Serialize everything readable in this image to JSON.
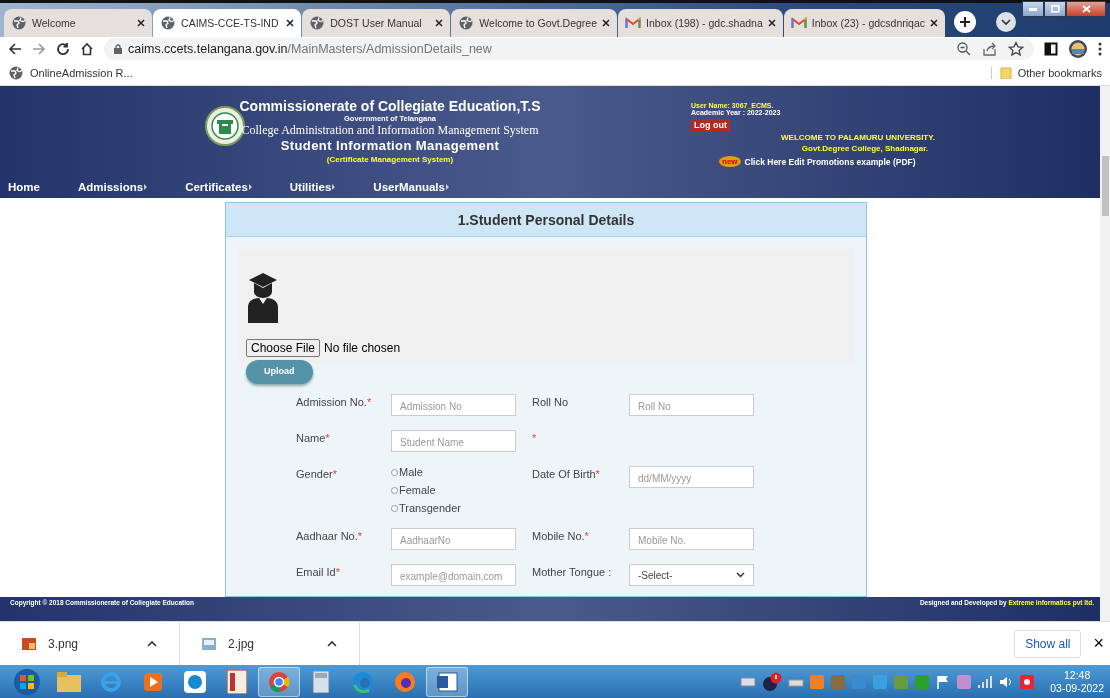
{
  "browser": {
    "tabs": [
      {
        "title": "Welcome",
        "kind": "globe",
        "selected": false
      },
      {
        "title": "CAIMS-CCE-TS-IND",
        "kind": "globe",
        "selected": true
      },
      {
        "title": "DOST User Manual",
        "kind": "globe",
        "selected": false
      },
      {
        "title": "Welcome to Govt.Degree",
        "kind": "globe",
        "selected": false
      },
      {
        "title": "Inbox (198) - gdc.shadna",
        "kind": "mail",
        "selected": false
      },
      {
        "title": "Inbox (23) - gdcsdnriqac",
        "kind": "mail",
        "selected": false
      }
    ],
    "url_host": "caims.ccets.telangana.gov.in",
    "url_path": "/MainMasters/AdmissionDetails_new",
    "bookmarks": [
      "OnlineAdmission R..."
    ],
    "other_bookmarks": "Other bookmarks"
  },
  "header": {
    "title": "Commissionerate of Collegiate Education,T.S",
    "subtitle": "Government of Telangana",
    "system": "College Administration and Information Management System",
    "module": "Student Information Management",
    "cms": "(Certificate Management System)",
    "user_name": "User Name:  3067_ECMS.",
    "academic_year": "Academic Year :  2022-2023",
    "logout": "Log out",
    "welcome": "WELCOME TO  PALAMURU UNIVERSITY.",
    "college": "Govt.Degree College, Shadnagar.",
    "promo_badge": "new",
    "promo_link": "Click Here Edit Promotions example (PDF)"
  },
  "nav": [
    {
      "label": "Home",
      "submenu": false
    },
    {
      "label": "Admissions",
      "submenu": true
    },
    {
      "label": "Certificates",
      "submenu": true
    },
    {
      "label": "Utilities",
      "submenu": true
    },
    {
      "label": "UserManuals",
      "submenu": true
    }
  ],
  "form": {
    "title": "1.Student Personal Details",
    "choose_file": "Choose File",
    "no_file": "No file chosen",
    "upload": "Upload",
    "rows": [
      [
        {
          "kind": "text",
          "label": "Admission No.",
          "mark": "*",
          "placeholder": "Admission No"
        },
        {
          "kind": "text",
          "label": "Roll No",
          "placeholder": "Roll No"
        }
      ],
      [
        {
          "kind": "text",
          "label": "Name",
          "mark": "*",
          "placeholder": "Student Name"
        },
        {
          "kind": "mark",
          "mark": "*"
        }
      ],
      [
        {
          "kind": "radio",
          "label": "Gender",
          "mark": "*",
          "options": [
            {
              "label": "Male",
              "selected": false
            },
            {
              "label": "Female",
              "selected": false
            },
            {
              "label": "Transgender",
              "selected": false
            }
          ]
        },
        {
          "kind": "text",
          "label": "Date Of Birth",
          "mark": "*",
          "placeholder": "dd/MM/yyyy"
        }
      ],
      [
        {
          "kind": "text",
          "label": "Aadhaar No.",
          "mark": "*",
          "placeholder": "AadhaarNo"
        },
        {
          "kind": "text",
          "label": "Mobile No.",
          "mark": "*",
          "placeholder": "Mobile No."
        }
      ],
      [
        {
          "kind": "text",
          "label": "Email Id",
          "mark": "*",
          "placeholder": "example@domain.com"
        },
        {
          "kind": "select",
          "label": "Mother Tongue :",
          "value": "-Select-"
        }
      ]
    ]
  },
  "footer": {
    "copyright": "Copyright © 2018 Commissionerate of Collegiate Education",
    "credit_prefix": "Designed and Developed by ",
    "credit_company": "Extreme informatics pvt ltd."
  },
  "downloads": {
    "files": [
      {
        "name": "3.png",
        "kind": "png"
      },
      {
        "name": "2.jpg",
        "kind": "jpg"
      }
    ],
    "show_all": "Show all",
    "close": "×"
  },
  "taskbar": {
    "time": "12:48",
    "date": "03-09-2022"
  }
}
